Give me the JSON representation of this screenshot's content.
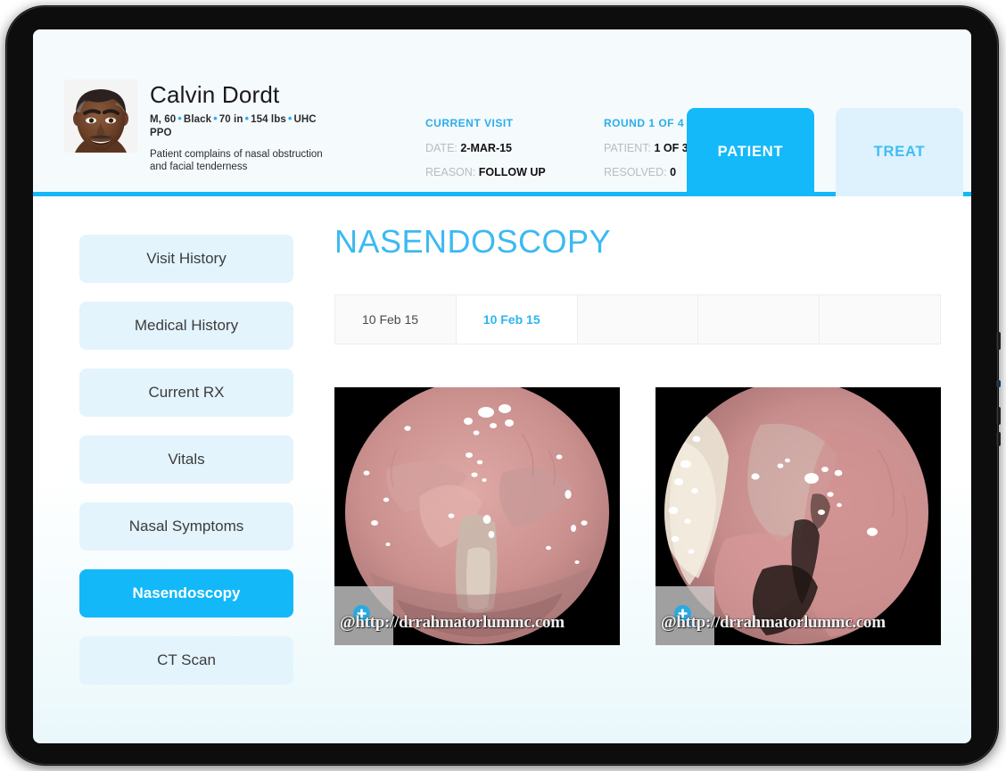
{
  "device": {
    "buttons": [
      "power-button",
      "volume-up-button",
      "volume-down-button",
      "port-indicator"
    ]
  },
  "header": {
    "patient": {
      "avatar_alt": "patient-photo",
      "name": "Calvin Dordt",
      "demographics": [
        "M, 60",
        "Black",
        "70 in",
        "154 lbs",
        "UHC PPO"
      ],
      "complaint": "Patient complains of nasal obstruction and facial tenderness"
    },
    "visit": {
      "heading": "CURRENT VISIT",
      "rows": [
        {
          "label": "DATE:",
          "value": "2-MAR-15"
        },
        {
          "label": "REASON:",
          "value": "FOLLOW UP"
        }
      ]
    },
    "round": {
      "heading_label": "ROUND",
      "heading_value": "1 OF 4",
      "rows": [
        {
          "label": "PATIENT:",
          "value": "1 OF 3"
        },
        {
          "label": "RESOLVED:",
          "value": "0"
        }
      ]
    },
    "tabs": [
      {
        "label": "PATIENT",
        "active": true
      },
      {
        "label": "TREAT",
        "active": false
      }
    ]
  },
  "sidebar": {
    "items": [
      {
        "label": "Visit History",
        "active": false
      },
      {
        "label": "Medical History",
        "active": false
      },
      {
        "label": "Current RX",
        "active": false
      },
      {
        "label": "Vitals",
        "active": false
      },
      {
        "label": "Nasal Symptoms",
        "active": false
      },
      {
        "label": "Nasendoscopy",
        "active": true
      },
      {
        "label": "CT Scan",
        "active": false
      }
    ]
  },
  "main": {
    "title": "NASENDOSCOPY",
    "date_tabs": [
      {
        "label": "10 Feb 15",
        "active": false
      },
      {
        "label": "10 Feb 15",
        "active": true
      },
      {
        "label": "",
        "active": false
      },
      {
        "label": "",
        "active": false
      },
      {
        "label": "",
        "active": false
      }
    ],
    "images": [
      {
        "alt": "nasendoscopy-image-1",
        "watermark": "@http://drrahmatorlummc.com",
        "zoom_icon": "zoom-in-icon"
      },
      {
        "alt": "nasendoscopy-image-2",
        "watermark": "@http://drrahmatorlummc.com",
        "zoom_icon": "zoom-in-icon"
      }
    ]
  },
  "colors": {
    "accent_blue": "#13b8f8",
    "title_blue": "#3cb9f2",
    "tab_inactive_bg": "#ddf2fd",
    "sidebar_item_bg": "#e3f4fd",
    "header_bg": "#f5fafd",
    "muted_label": "#b9bdc0"
  }
}
